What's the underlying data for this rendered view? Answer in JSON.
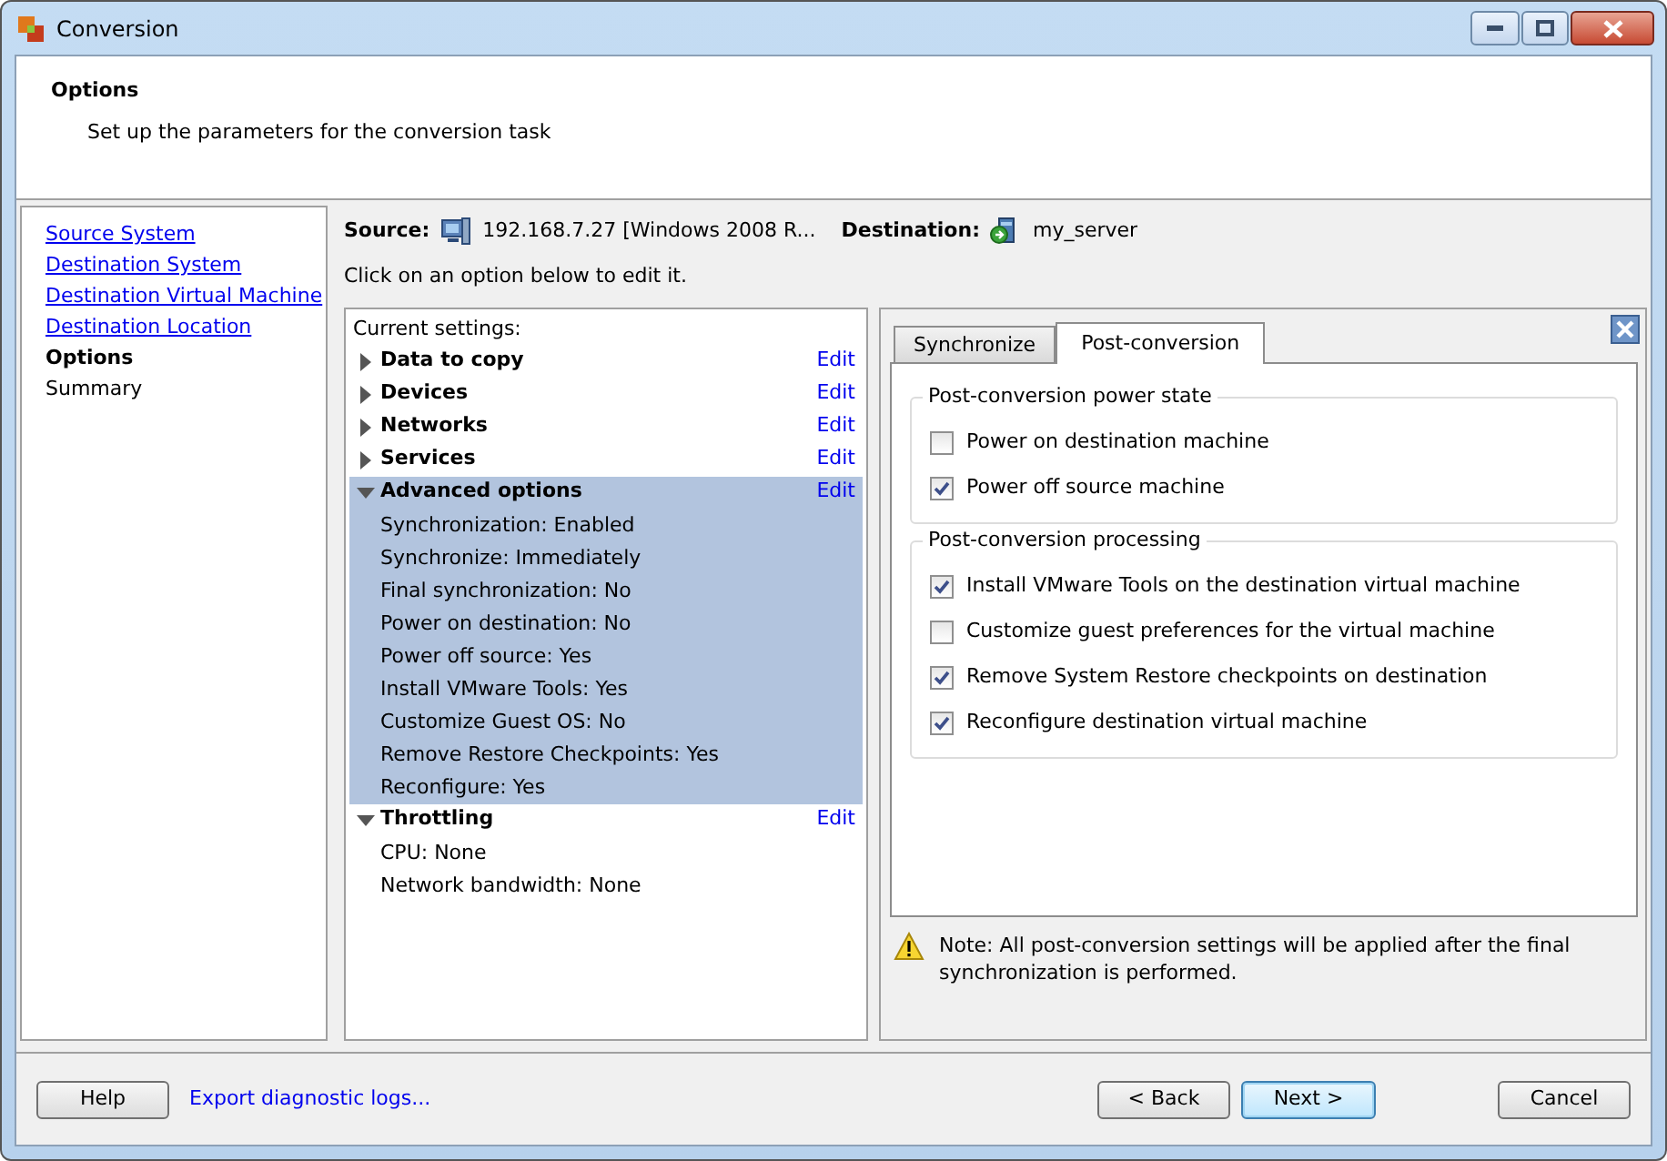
{
  "window": {
    "title": "Conversion"
  },
  "header": {
    "title": "Options",
    "subtitle": "Set up the parameters for the conversion task"
  },
  "steps": [
    {
      "label": "Source System",
      "kind": "link"
    },
    {
      "label": "Destination System",
      "kind": "link"
    },
    {
      "label": "Destination Virtual Machine",
      "kind": "link"
    },
    {
      "label": "Destination Location",
      "kind": "link"
    },
    {
      "label": "Options",
      "kind": "current"
    },
    {
      "label": "Summary",
      "kind": "pending"
    }
  ],
  "source": {
    "label": "Source:",
    "value": "192.168.7.27 [Windows 2008 R..."
  },
  "destination": {
    "label": "Destination:",
    "value": "my_server"
  },
  "instruction": "Click on an option below to edit it.",
  "settings": {
    "heading": "Current settings:",
    "groups": [
      {
        "label": "Data to copy",
        "expanded": false,
        "selected": false,
        "edit": "Edit"
      },
      {
        "label": "Devices",
        "expanded": false,
        "selected": false,
        "edit": "Edit"
      },
      {
        "label": "Networks",
        "expanded": false,
        "selected": false,
        "edit": "Edit"
      },
      {
        "label": "Services",
        "expanded": false,
        "selected": false,
        "edit": "Edit"
      },
      {
        "label": "Advanced options",
        "expanded": true,
        "selected": true,
        "edit": "Edit",
        "details": [
          "Synchronization: Enabled",
          "Synchronize: Immediately",
          "Final synchronization: No",
          "Power on destination: No",
          "Power off source: Yes",
          "Install VMware Tools: Yes",
          "Customize Guest OS: No",
          "Remove Restore Checkpoints: Yes",
          "Reconfigure: Yes"
        ]
      },
      {
        "label": "Throttling",
        "expanded": true,
        "selected": false,
        "edit": "Edit",
        "details": [
          "CPU: None",
          "Network bandwidth: None"
        ]
      }
    ]
  },
  "tabs": [
    {
      "label": "Synchronize",
      "selected": false
    },
    {
      "label": "Post-conversion",
      "selected": true
    }
  ],
  "groups": [
    {
      "title": "Post-conversion power state",
      "options": [
        {
          "label": "Power on destination machine",
          "checked": false
        },
        {
          "label": "Power off source machine",
          "checked": true
        }
      ]
    },
    {
      "title": "Post-conversion processing",
      "options": [
        {
          "label": "Install VMware Tools on the destination virtual machine",
          "checked": true
        },
        {
          "label": "Customize guest preferences for the virtual machine",
          "checked": false
        },
        {
          "label": "Remove System Restore checkpoints on destination",
          "checked": true
        },
        {
          "label": "Reconfigure destination virtual machine",
          "checked": true
        }
      ]
    }
  ],
  "note": "Note: All post-conversion settings will be applied after the final synchronization is performed.",
  "footer": {
    "help": "Help",
    "export": "Export diagnostic logs...",
    "back": "< Back",
    "next": "Next >",
    "cancel": "Cancel"
  }
}
